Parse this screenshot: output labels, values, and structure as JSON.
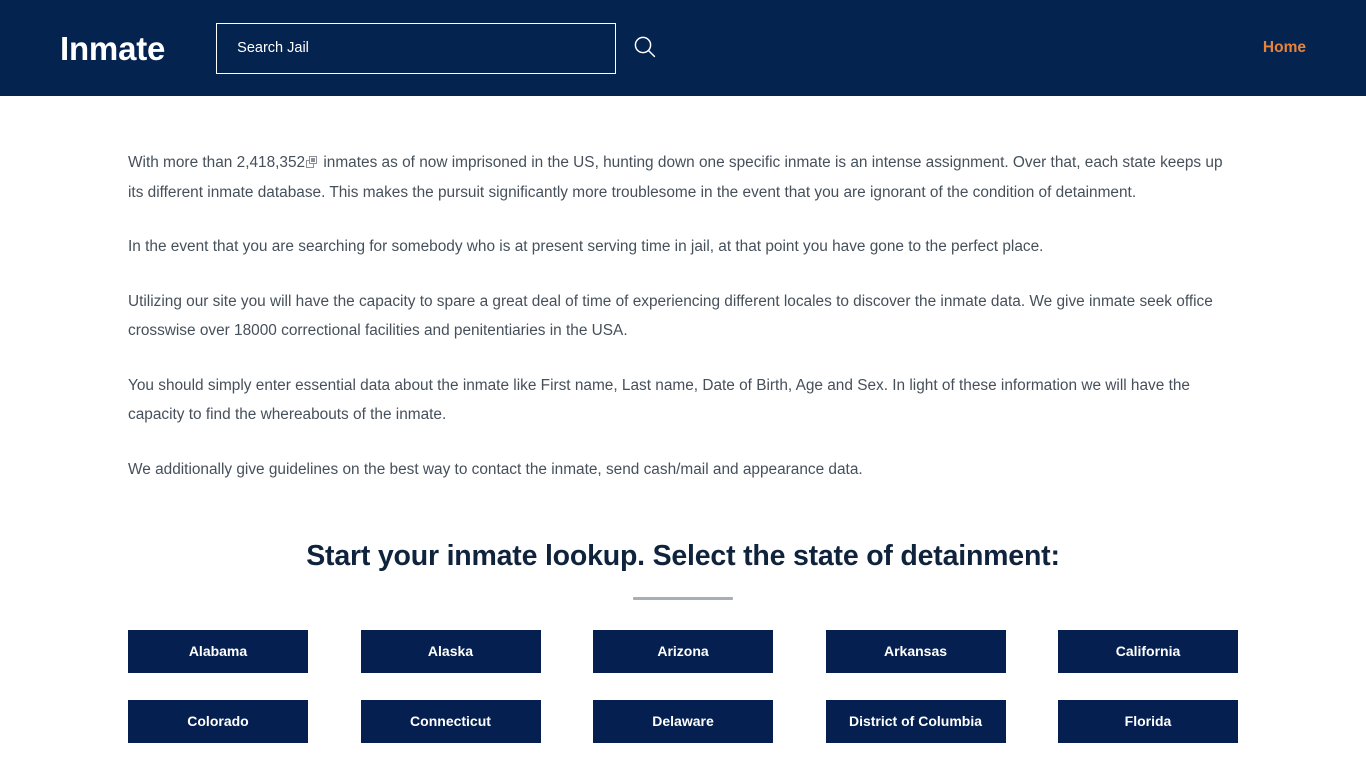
{
  "header": {
    "brand": "Inmate",
    "search": {
      "placeholder": "Search Jail",
      "value": "",
      "icon": "search-icon"
    },
    "nav": [
      {
        "label": "Home",
        "color": "#e8833a"
      }
    ]
  },
  "main": {
    "paragraphs": [
      {
        "segments": [
          {
            "type": "text",
            "text": "With more than 2,418,352"
          },
          {
            "type": "icon",
            "icon": "copy-window-icon"
          },
          {
            "type": "text",
            "text": " inmates as of now imprisoned in the US, hunting down one specific inmate is an intense assignment. Over that, each state keeps up its different inmate database. This makes the pursuit significantly more troublesome in the event that you are ignorant of the condition of detainment."
          }
        ]
      },
      {
        "segments": [
          {
            "type": "text",
            "text": "In the event that you are searching for somebody who is at present serving time in jail, at that point you have gone to the perfect place."
          }
        ]
      },
      {
        "segments": [
          {
            "type": "text",
            "text": "Utilizing our site you will have the capacity to spare a great deal of time of experiencing different locales to discover the inmate data. We give inmate seek office crosswise over 18000 correctional facilities and penitentiaries in the USA."
          }
        ]
      },
      {
        "segments": [
          {
            "type": "text",
            "text": "You should simply enter essential data about the inmate like First name, Last name, Date of Birth, Age and Sex. In light of these information we will have the capacity to find the whereabouts of the inmate."
          }
        ]
      },
      {
        "segments": [
          {
            "type": "text",
            "text": "We additionally give guidelines on the best way to contact the inmate, send cash/mail and appearance data."
          }
        ]
      }
    ],
    "section_heading": "Start your inmate lookup. Select the state of detainment:",
    "states": [
      "Alabama",
      "Alaska",
      "Arizona",
      "Arkansas",
      "California",
      "Colorado",
      "Connecticut",
      "Delaware",
      "District of Columbia",
      "Florida"
    ]
  },
  "colors": {
    "navy": "#04234f",
    "button_navy": "#052050",
    "accent_orange": "#e8833a",
    "body_text": "#46505b",
    "heading": "#10233d",
    "divider": "#a9adb5",
    "page_background": "#ffffff"
  }
}
